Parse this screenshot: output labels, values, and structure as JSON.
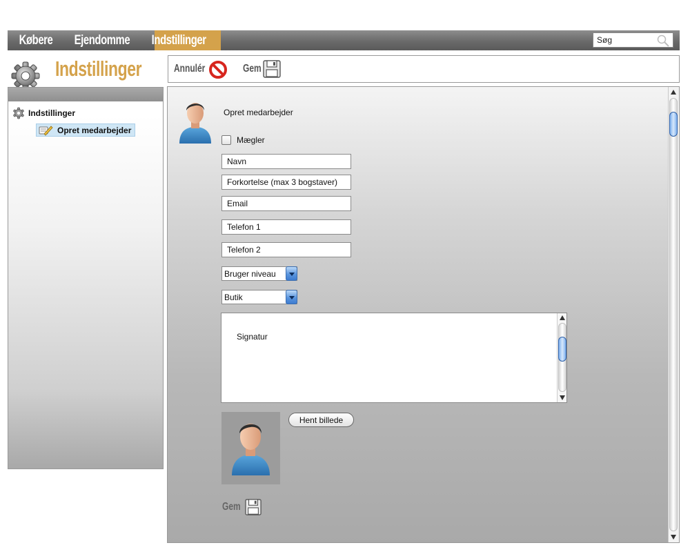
{
  "nav": {
    "items": [
      {
        "label": "Købere"
      },
      {
        "label": "Ejendomme"
      },
      {
        "label": "Indstillinger",
        "active": true
      }
    ],
    "active_color": "#d4a24b"
  },
  "search": {
    "placeholder": "Søg"
  },
  "header": {
    "title": "Indstillinger"
  },
  "toolbar": {
    "cancel_label": "Annulér",
    "save_label": "Gem"
  },
  "tree": {
    "root_label": "Indstillinger",
    "child_label": "Opret medarbejder"
  },
  "form": {
    "title": "Opret medarbejder",
    "broker_checkbox_label": "Mægler",
    "broker_checked": false,
    "fields": {
      "name": "Navn",
      "abbreviation": "Forkortelse (max 3 bogstaver)",
      "email": "Email",
      "phone1": "Telefon 1",
      "phone2": "Telefon 2"
    },
    "user_level": "Bruger niveau",
    "shop": "Butik",
    "signature": "Signatur",
    "fetch_image_label": "Hent billede",
    "save_label": "Gem"
  }
}
